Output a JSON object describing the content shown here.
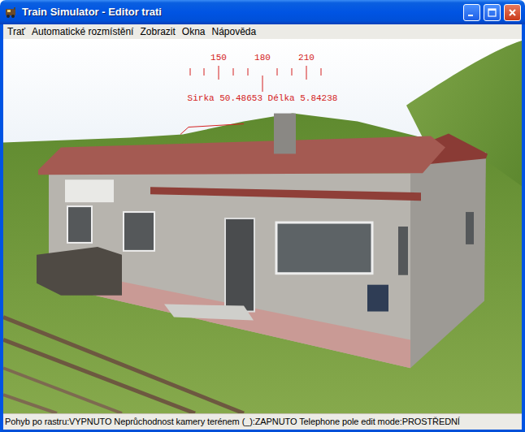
{
  "window": {
    "title": "Train Simulator - Editor trati"
  },
  "menu": [
    {
      "label": "Trať"
    },
    {
      "label": "Automatické rozmístění"
    },
    {
      "label": "Zobrazit"
    },
    {
      "label": "Okna"
    },
    {
      "label": "Nápověda"
    }
  ],
  "compass": {
    "labels": [
      "150",
      "180",
      "210"
    ],
    "readout": "Sirka 50.48653 Délka 5.84238"
  },
  "status_bar": "Pohyb po rastru:VYPNUTO Neprůchodnost kamery terénem (_):ZAPNUTO Telephone pole edit mode:PROSTŘEDNÍ"
}
